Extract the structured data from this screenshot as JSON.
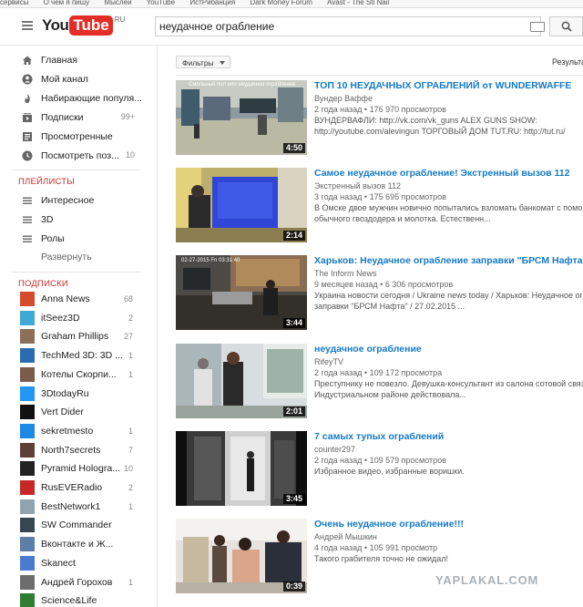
{
  "bookmarks": [
    "сервисы",
    "О чём я пишу",
    "Мыслей",
    "YouTube",
    "ИстРибанция",
    "Dark Money Forum",
    "Avast - The Sti Nail"
  ],
  "masthead": {
    "logo_you": "You",
    "logo_tube": "Tube",
    "logo_region": "RU",
    "search_query": "неудачное ограбление"
  },
  "sidebar": {
    "nav": [
      {
        "label": "Главная",
        "count": "",
        "icon": "home-icon"
      },
      {
        "label": "Мой канал",
        "count": "",
        "icon": "user-icon"
      },
      {
        "label": "Набирающие популя...",
        "count": "",
        "icon": "flame-icon"
      },
      {
        "label": "Подписки",
        "count": "99+",
        "icon": "subscriptions-icon"
      },
      {
        "label": "Просмотренные",
        "count": "",
        "icon": "history-icon"
      },
      {
        "label": "Посмотреть поз...",
        "count": "10",
        "icon": "clock-icon"
      }
    ],
    "playlists_title": "ПЛЕЙЛИСТЫ",
    "playlists": [
      {
        "label": "Интересное"
      },
      {
        "label": "3D"
      },
      {
        "label": "Ролы"
      }
    ],
    "expand_label": "Развернуть",
    "subscriptions_title": "ПОДПИСКИ",
    "subscriptions": [
      {
        "label": "Anna News",
        "count": "68",
        "color": "#d64b2e"
      },
      {
        "label": "itSeez3D",
        "count": "2",
        "color": "#3fa9d6"
      },
      {
        "label": "Graham Phillips",
        "count": "27",
        "color": "#8b6f5a"
      },
      {
        "label": "TechMed 3D: 3D ...",
        "count": "1",
        "color": "#2b6cb0"
      },
      {
        "label": "Котелы Скорпи...",
        "count": "1",
        "color": "#7a5c4a"
      },
      {
        "label": "3DtodayRu",
        "count": "",
        "color": "#2196f3"
      },
      {
        "label": "Vert Dider",
        "count": "",
        "color": "#111111"
      },
      {
        "label": "sekretmesto",
        "count": "1",
        "color": "#1e88e5"
      },
      {
        "label": "North7secrets",
        "count": "7",
        "color": "#5d4037"
      },
      {
        "label": "Pyramid Hologra...",
        "count": "10",
        "color": "#222222"
      },
      {
        "label": "RusEVERadio",
        "count": "2",
        "color": "#c62828"
      },
      {
        "label": "BestNetwork1",
        "count": "1",
        "color": "#90a4ae"
      },
      {
        "label": "SW Commander",
        "count": "",
        "color": "#37474f"
      },
      {
        "label": "Вконтакте и Ж...",
        "count": "",
        "color": "#5b7fa6"
      },
      {
        "label": "Skanect",
        "count": "",
        "color": "#4a7bd0"
      },
      {
        "label": "Андрей Горохов",
        "count": "1",
        "color": "#6d6d6d"
      },
      {
        "label": "Science&Life",
        "count": "",
        "color": "#2e7d32"
      }
    ]
  },
  "results": {
    "filters_label": "Фильтры",
    "results_label": "Результаты",
    "videos": [
      {
        "title": "ТОП 10 НЕУДАЧНЫХ ОГРАБЛЕНИЙ от WUNDERWAFFE",
        "channel": "Вундер Ваффе",
        "age": "2 года назад",
        "views": "176 970 просмотров",
        "desc1": "ВУНДЕРВАФЛИ: http://vk.com/vk_guns ALEX GUNS SHOW:",
        "desc2": "http://youtube.com/alevingun ТОРГОВЫЙ ДОМ TUT.RU: http://tut.ru/",
        "duration": "4:50",
        "thumb_caption": "Смольный пол или неудачное ограбление"
      },
      {
        "title": "Самое неудачное ограбление! Экстренный вызов 112",
        "channel": "Экстренный вызов 112",
        "age": "3 года назад",
        "views": "175 695 просмотров",
        "desc1": "В Омске двое мужчин новично попытались взломать банкомат с помощью",
        "desc2": "обычного гвоздодера и молотка. Естественн...",
        "duration": "2:14",
        "thumb_caption": ""
      },
      {
        "title": "Харьков: Неудачное ограбление заправки \"БРСМ Нафта\"",
        "channel": "The Inform News",
        "age": "9 месяцев назад",
        "views": "6 306 просмотров",
        "desc1": "Украина новости сегодня / Ukraine news today / Харьков: Неудачное ог",
        "desc2": "заправки \"БРСМ Нафта\" / 27.02.2015 ...",
        "duration": "3:44",
        "thumb_caption": "02-27-2015 Fri 03:31:40"
      },
      {
        "title": "неудачное ограбление",
        "channel": "RifeyTV",
        "age": "2 года назад",
        "views": "109 172 просмотра",
        "desc1": "Преступнику не повезло. Девушка-консультант из салона сотовой связи",
        "desc2": "Индустриальном районе действовала...",
        "duration": "2:01",
        "thumb_caption": ""
      },
      {
        "title": "7 самых тупых ограблений",
        "channel": "counter297",
        "age": "2 года назад",
        "views": "109 579 просмотров",
        "desc1": "Избранное видео, избранные воришки.",
        "desc2": "",
        "duration": "3:45",
        "thumb_caption": ""
      },
      {
        "title": "Очень неудачное ограбление!!!",
        "channel": "Андрей Мышкин",
        "age": "4 года назад",
        "views": "105 991 просмотр",
        "desc1": "Такого грабителя точно не ожидал!",
        "desc2": "",
        "duration": "0:39",
        "thumb_caption": ""
      }
    ]
  },
  "watermark": "YAPLAKAL.COM"
}
